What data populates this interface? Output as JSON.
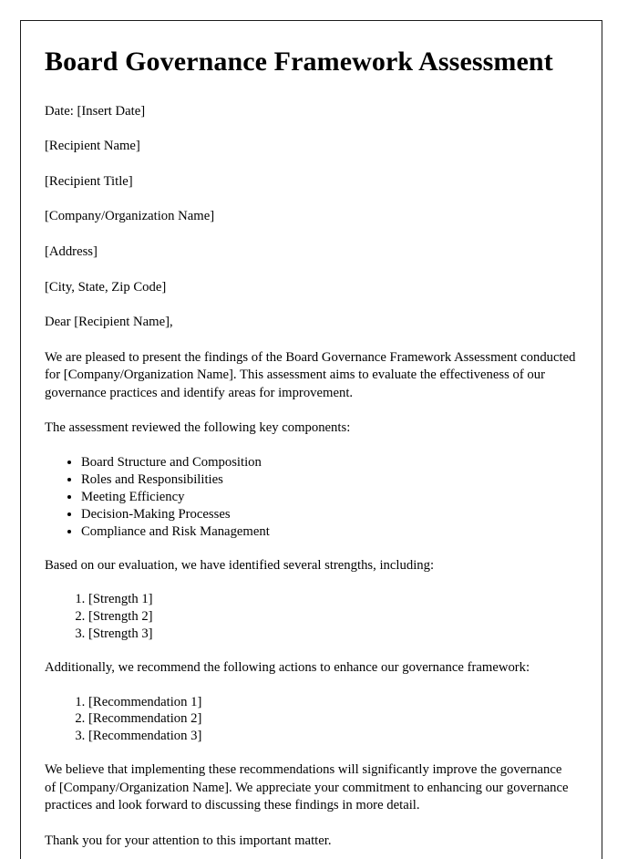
{
  "document": {
    "title": "Board Governance Framework Assessment",
    "date_line": "Date: [Insert Date]",
    "recipient_block": [
      "[Recipient Name]",
      "[Recipient Title]",
      "[Company/Organization Name]",
      "[Address]",
      "[City, State, Zip Code]"
    ],
    "salutation": "Dear [Recipient Name],",
    "intro_paragraph": "We are pleased to present the findings of the Board Governance Framework Assessment conducted for [Company/Organization Name]. This assessment aims to evaluate the effectiveness of our governance practices and identify areas for improvement.",
    "components_intro": "The assessment reviewed the following key components:",
    "components": [
      "Board Structure and Composition",
      "Roles and Responsibilities",
      "Meeting Efficiency",
      "Decision-Making Processes",
      "Compliance and Risk Management"
    ],
    "strengths_intro": "Based on our evaluation, we have identified several strengths, including:",
    "strengths": [
      "[Strength 1]",
      "[Strength 2]",
      "[Strength 3]"
    ],
    "recommendations_intro": "Additionally, we recommend the following actions to enhance our governance framework:",
    "recommendations": [
      "[Recommendation 1]",
      "[Recommendation 2]",
      "[Recommendation 3]"
    ],
    "closing_paragraph": "We believe that implementing these recommendations will significantly improve the governance of [Company/Organization Name]. We appreciate your commitment to enhancing our governance practices and look forward to discussing these findings in more detail.",
    "thanks_paragraph": "Thank you for your attention to this important matter."
  }
}
